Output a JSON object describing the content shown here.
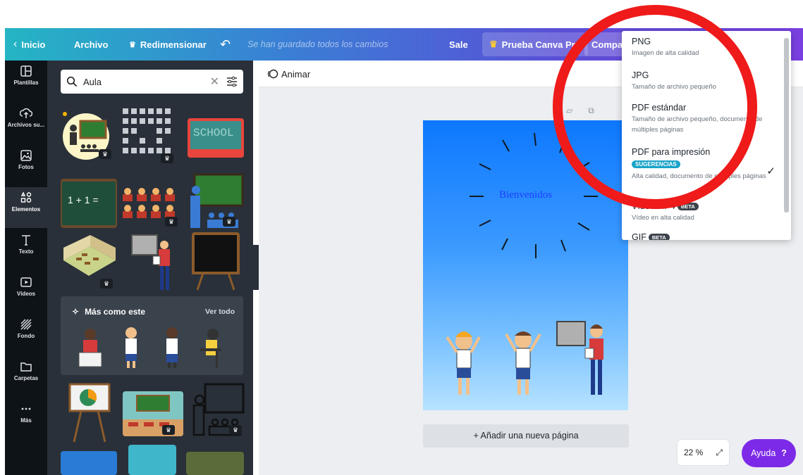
{
  "topbar": {
    "home": "Inicio",
    "file": "Archivo",
    "resize": "Redimensionar",
    "saved": "Se han guardado todos los cambios",
    "sale": "Sale",
    "pro": "Prueba Canva Pro",
    "share": "Compa"
  },
  "rail": [
    {
      "label": "Plantillas",
      "icon": "templates-icon"
    },
    {
      "label": "Archivos su...",
      "icon": "uploads-icon"
    },
    {
      "label": "Fotos",
      "icon": "photos-icon"
    },
    {
      "label": "Elementos",
      "icon": "elements-icon",
      "active": true
    },
    {
      "label": "Texto",
      "icon": "text-icon"
    },
    {
      "label": "Vídeos",
      "icon": "videos-icon"
    },
    {
      "label": "Fondo",
      "icon": "background-icon"
    },
    {
      "label": "Carpetas",
      "icon": "folders-icon"
    },
    {
      "label": "Más",
      "icon": "more-icon"
    }
  ],
  "panel": {
    "search_value": "Aula",
    "thumb_school": "SCHOOL",
    "thumb_math": "1 + 1 =",
    "more_title": "Más como este",
    "more_all": "Ver todo"
  },
  "canvas": {
    "animate": "Animar",
    "welcome": "Bienvenidos",
    "add_page": "+ Añadir una nueva página",
    "zoom": "22 %",
    "help": "Ayuda",
    "help_icon": "?"
  },
  "dropdown": {
    "items": [
      {
        "title": "PNG",
        "sub": "Imagen de alta calidad"
      },
      {
        "title": "JPG",
        "sub": "Tamaño de archivo pequeño"
      },
      {
        "title": "PDF estándar",
        "sub": "Tamaño de archivo pequeño, documento de múltiples páginas"
      },
      {
        "title": "PDF para impresión",
        "badge": "SUGERENCIAS",
        "sub": "Alta calidad, documento de múltiples páginas"
      },
      {
        "title": "Vídeo MP4",
        "badge": "BETA",
        "sub": "Vídeo en alta calidad"
      },
      {
        "title": "GIF",
        "badge": "BETA"
      }
    ]
  },
  "colors": {
    "accent": "#7d2ae8",
    "annotation_ring": "#ef1a1a",
    "sidebar": "#0e1318",
    "panel": "#293039"
  }
}
